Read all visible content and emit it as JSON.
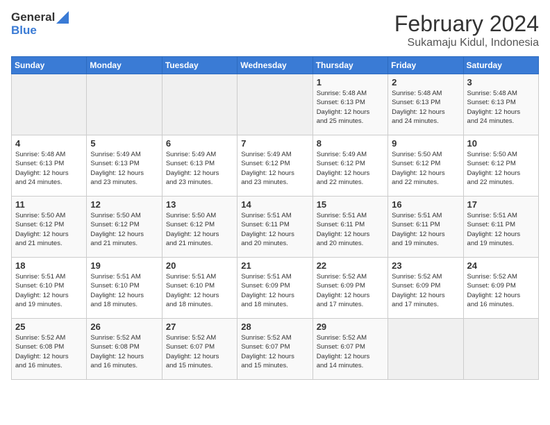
{
  "header": {
    "logo_general": "General",
    "logo_blue": "Blue",
    "month_year": "February 2024",
    "location": "Sukamaju Kidul, Indonesia"
  },
  "days_of_week": [
    "Sunday",
    "Monday",
    "Tuesday",
    "Wednesday",
    "Thursday",
    "Friday",
    "Saturday"
  ],
  "weeks": [
    [
      {
        "day": "",
        "info": ""
      },
      {
        "day": "",
        "info": ""
      },
      {
        "day": "",
        "info": ""
      },
      {
        "day": "",
        "info": ""
      },
      {
        "day": "1",
        "info": "Sunrise: 5:48 AM\nSunset: 6:13 PM\nDaylight: 12 hours\nand 25 minutes."
      },
      {
        "day": "2",
        "info": "Sunrise: 5:48 AM\nSunset: 6:13 PM\nDaylight: 12 hours\nand 24 minutes."
      },
      {
        "day": "3",
        "info": "Sunrise: 5:48 AM\nSunset: 6:13 PM\nDaylight: 12 hours\nand 24 minutes."
      }
    ],
    [
      {
        "day": "4",
        "info": "Sunrise: 5:48 AM\nSunset: 6:13 PM\nDaylight: 12 hours\nand 24 minutes."
      },
      {
        "day": "5",
        "info": "Sunrise: 5:49 AM\nSunset: 6:13 PM\nDaylight: 12 hours\nand 23 minutes."
      },
      {
        "day": "6",
        "info": "Sunrise: 5:49 AM\nSunset: 6:13 PM\nDaylight: 12 hours\nand 23 minutes."
      },
      {
        "day": "7",
        "info": "Sunrise: 5:49 AM\nSunset: 6:12 PM\nDaylight: 12 hours\nand 23 minutes."
      },
      {
        "day": "8",
        "info": "Sunrise: 5:49 AM\nSunset: 6:12 PM\nDaylight: 12 hours\nand 22 minutes."
      },
      {
        "day": "9",
        "info": "Sunrise: 5:50 AM\nSunset: 6:12 PM\nDaylight: 12 hours\nand 22 minutes."
      },
      {
        "day": "10",
        "info": "Sunrise: 5:50 AM\nSunset: 6:12 PM\nDaylight: 12 hours\nand 22 minutes."
      }
    ],
    [
      {
        "day": "11",
        "info": "Sunrise: 5:50 AM\nSunset: 6:12 PM\nDaylight: 12 hours\nand 21 minutes."
      },
      {
        "day": "12",
        "info": "Sunrise: 5:50 AM\nSunset: 6:12 PM\nDaylight: 12 hours\nand 21 minutes."
      },
      {
        "day": "13",
        "info": "Sunrise: 5:50 AM\nSunset: 6:12 PM\nDaylight: 12 hours\nand 21 minutes."
      },
      {
        "day": "14",
        "info": "Sunrise: 5:51 AM\nSunset: 6:11 PM\nDaylight: 12 hours\nand 20 minutes."
      },
      {
        "day": "15",
        "info": "Sunrise: 5:51 AM\nSunset: 6:11 PM\nDaylight: 12 hours\nand 20 minutes."
      },
      {
        "day": "16",
        "info": "Sunrise: 5:51 AM\nSunset: 6:11 PM\nDaylight: 12 hours\nand 19 minutes."
      },
      {
        "day": "17",
        "info": "Sunrise: 5:51 AM\nSunset: 6:11 PM\nDaylight: 12 hours\nand 19 minutes."
      }
    ],
    [
      {
        "day": "18",
        "info": "Sunrise: 5:51 AM\nSunset: 6:10 PM\nDaylight: 12 hours\nand 19 minutes."
      },
      {
        "day": "19",
        "info": "Sunrise: 5:51 AM\nSunset: 6:10 PM\nDaylight: 12 hours\nand 18 minutes."
      },
      {
        "day": "20",
        "info": "Sunrise: 5:51 AM\nSunset: 6:10 PM\nDaylight: 12 hours\nand 18 minutes."
      },
      {
        "day": "21",
        "info": "Sunrise: 5:51 AM\nSunset: 6:09 PM\nDaylight: 12 hours\nand 18 minutes."
      },
      {
        "day": "22",
        "info": "Sunrise: 5:52 AM\nSunset: 6:09 PM\nDaylight: 12 hours\nand 17 minutes."
      },
      {
        "day": "23",
        "info": "Sunrise: 5:52 AM\nSunset: 6:09 PM\nDaylight: 12 hours\nand 17 minutes."
      },
      {
        "day": "24",
        "info": "Sunrise: 5:52 AM\nSunset: 6:09 PM\nDaylight: 12 hours\nand 16 minutes."
      }
    ],
    [
      {
        "day": "25",
        "info": "Sunrise: 5:52 AM\nSunset: 6:08 PM\nDaylight: 12 hours\nand 16 minutes."
      },
      {
        "day": "26",
        "info": "Sunrise: 5:52 AM\nSunset: 6:08 PM\nDaylight: 12 hours\nand 16 minutes."
      },
      {
        "day": "27",
        "info": "Sunrise: 5:52 AM\nSunset: 6:07 PM\nDaylight: 12 hours\nand 15 minutes."
      },
      {
        "day": "28",
        "info": "Sunrise: 5:52 AM\nSunset: 6:07 PM\nDaylight: 12 hours\nand 15 minutes."
      },
      {
        "day": "29",
        "info": "Sunrise: 5:52 AM\nSunset: 6:07 PM\nDaylight: 12 hours\nand 14 minutes."
      },
      {
        "day": "",
        "info": ""
      },
      {
        "day": "",
        "info": ""
      }
    ]
  ]
}
